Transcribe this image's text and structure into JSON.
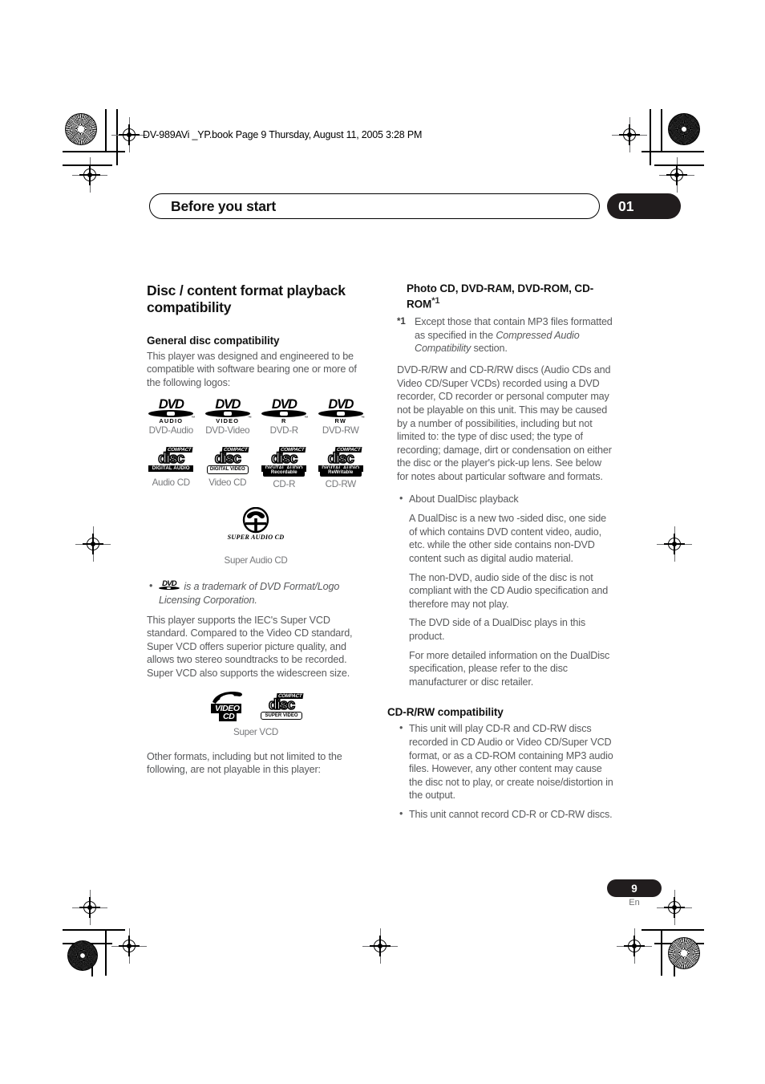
{
  "printer_marks": {
    "file_line": "DV-989AVi _YP.book  Page 9  Thursday, August 11, 2005  3:28 PM"
  },
  "chapter_header": {
    "title": "Before you start",
    "number": "01"
  },
  "left_column": {
    "section_title": "Disc / content format playback compatibility",
    "sub_title": "General disc compatibility",
    "intro": "This player was designed and engineered to be compatible with software bearing one or more of the following logos:",
    "logos_row1": [
      {
        "caption": "DVD-Audio",
        "icon": "dvd-audio-logo",
        "sub": "AUDIO"
      },
      {
        "caption": "DVD-Video",
        "icon": "dvd-video-logo",
        "sub": "VIDEO"
      },
      {
        "caption": "DVD-R",
        "icon": "dvd-r-logo",
        "sub": "R"
      },
      {
        "caption": "DVD-RW",
        "icon": "dvd-rw-logo",
        "sub": "RW"
      }
    ],
    "logos_row2": [
      {
        "caption": "Audio CD",
        "icon": "compact-disc-digital-audio-logo",
        "top": "COMPACT",
        "word": "disc",
        "band": "DIGITAL AUDIO"
      },
      {
        "caption": "Video CD",
        "icon": "compact-disc-digital-video-logo",
        "top": "COMPACT",
        "word": "disc",
        "band": "DIGITAL VIDEO"
      },
      {
        "caption": "CD-R",
        "icon": "compact-disc-recordable-logo",
        "top": "COMPACT",
        "word": "disc",
        "band": "DIGITAL AUDIO",
        "band2": "Recordable"
      },
      {
        "caption": "CD-RW",
        "icon": "compact-disc-rewritable-logo",
        "top": "COMPACT",
        "word": "disc",
        "band": "DIGITAL AUDIO",
        "band2": "ReWritable"
      }
    ],
    "sacd": {
      "caption": "Super Audio CD",
      "icon": "super-audio-cd-logo",
      "mark_text": "SUPER AUDIO CD"
    },
    "trademark_note": "is a trademark of DVD Format/Logo Licensing Corporation.",
    "super_vcd_paragraph": "This player supports the IEC's Super VCD standard. Compared to the Video CD standard, Super VCD offers superior picture quality, and allows two stereo soundtracks to be recorded. Super VCD also supports the widescreen size.",
    "svcd_logos": {
      "caption": "Super VCD",
      "video_cd": {
        "icon": "video-cd-logo",
        "line1": "VIDEO",
        "line2": "CD"
      },
      "compact_disc": {
        "icon": "compact-disc-super-video-logo",
        "top": "COMPACT",
        "word": "disc",
        "band": "SUPER VIDEO"
      }
    },
    "other_formats": "Other formats, including but not limited to the following, are not playable in this player:"
  },
  "right_column": {
    "unsupported_heading": "Photo CD, DVD-RAM, DVD-ROM, CD-ROM",
    "unsupported_heading_mark": "*1",
    "footnote_mark": "*1",
    "footnote_text_1": "Except those that contain MP3 files formatted as specified in the ",
    "footnote_italic": "Compressed Audio Compatibility",
    "footnote_text_2": " section.",
    "recorded_discs_paragraph": "DVD-R/RW and CD-R/RW discs (Audio CDs and Video CD/Super VCDs) recorded using a DVD recorder, CD recorder or personal computer may not be playable on this unit. This may be caused by a number of possibilities, including but not limited to: the type of disc used; the type of recording; damage, dirt or condensation on either the disc or the player's pick-up lens. See below for notes about particular software and formats.",
    "dualdisc_bullet": "About DualDisc playback",
    "dualdisc_paragraphs": [
      "A DualDisc is a new two -sided disc, one side of which contains DVD content video, audio, etc. while the other side contains non-DVD content such as digital audio material.",
      "The non-DVD, audio side of the disc is not compliant with the CD Audio specification and therefore may not play.",
      "The DVD side of a DualDisc plays in this product.",
      "For more detailed information on the DualDisc specification, please refer to the disc manufacturer or disc retailer."
    ],
    "cdrrw_heading": "CD-R/RW compatibility",
    "cdrrw_bullets": [
      "This unit will play CD-R and CD-RW discs recorded in CD Audio or Video CD/Super VCD format, or as a CD-ROM containing MP3 audio files. However, any other content may cause the disc not to play, or create noise/distortion in the output.",
      "This unit cannot record CD-R or CD-RW discs."
    ]
  },
  "footer": {
    "page_number": "9",
    "language": "En"
  },
  "colors": {
    "body_text": "#58595b",
    "heading_text": "#111111",
    "badge_bg": "#211d1e",
    "caption_text": "#77787b"
  }
}
